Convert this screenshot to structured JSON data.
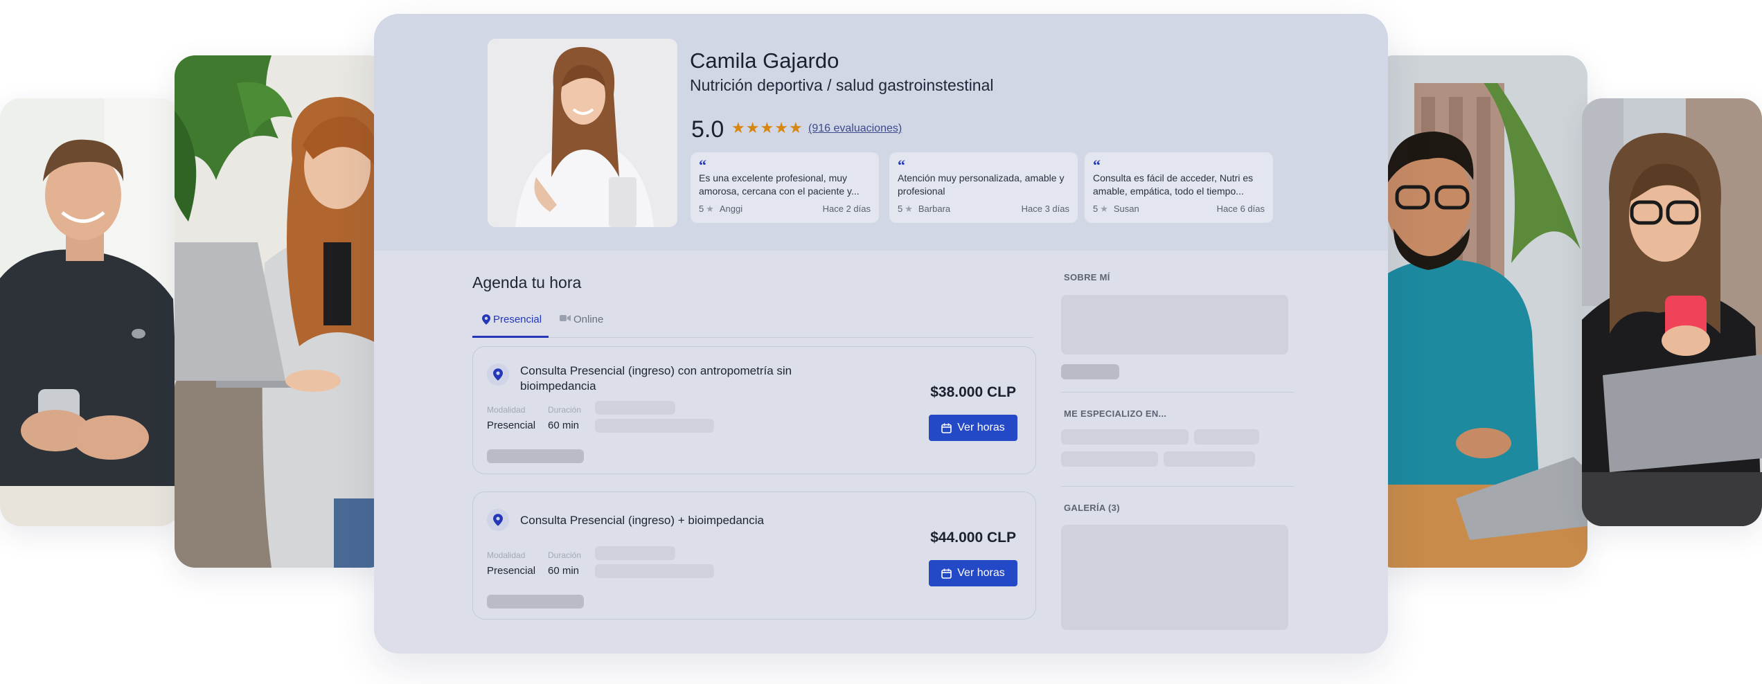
{
  "professional": {
    "name": "Camila Gajardo",
    "specialty": "Nutrición deportiva / salud gastroinstestinal",
    "rating_value": "5.0",
    "stars": 5,
    "reviews_count": "(916 evaluaciones)"
  },
  "reviews": [
    {
      "quote_mark": "“",
      "text": "Es una excelente profesional, muy amorosa, cercana con el paciente y...",
      "score": "5",
      "author": "Anggi",
      "ago": "Hace 2 días"
    },
    {
      "quote_mark": "“",
      "text": "Atención muy personalizada, amable y profesional",
      "score": "5",
      "author": "Barbara",
      "ago": "Hace 3 días"
    },
    {
      "quote_mark": "“",
      "text": "Consulta es fácil de acceder, Nutri es amable, empática, todo el tiempo...",
      "score": "5",
      "author": "Susan",
      "ago": "Hace 6 días"
    }
  ],
  "agenda": {
    "title": "Agenda tu hora",
    "tabs": [
      {
        "label": "Presencial",
        "active": true
      },
      {
        "label": "Online",
        "active": false
      }
    ]
  },
  "services": [
    {
      "title": "Consulta Presencial (ingreso) con antropometría sin bioimpedancia",
      "modality_label": "Modalidad",
      "modality_value": "Presencial",
      "duration_label": "Duración",
      "duration_value": "60 min",
      "price": "$38.000 CLP",
      "button_label": "Ver horas"
    },
    {
      "title": "Consulta Presencial (ingreso) + bioimpedancia",
      "modality_label": "Modalidad",
      "modality_value": "Presencial",
      "duration_label": "Duración",
      "duration_value": "60 min",
      "price": "$44.000 CLP",
      "button_label": "Ver horas"
    }
  ],
  "sidebar": {
    "about_heading": "SOBRE MÍ",
    "specialize_heading": "ME ESPECIALIZO EN...",
    "gallery_heading": "GALERÍA (3)"
  },
  "colors": {
    "accent": "#2337b8",
    "button": "#2449c6",
    "star": "#d7860f",
    "panel_bg": "#dcdfe9",
    "hero_bg": "#d2d7e6"
  }
}
